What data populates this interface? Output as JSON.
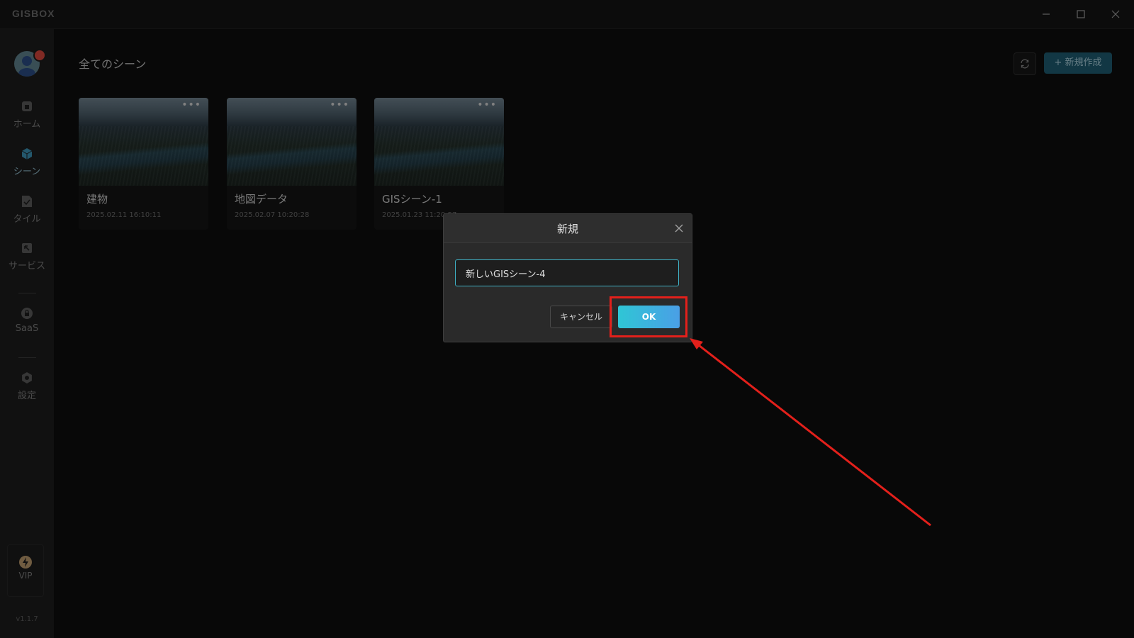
{
  "app": {
    "logo": "GISBOX"
  },
  "sidebar": {
    "items": [
      {
        "id": "home",
        "label": "ホーム"
      },
      {
        "id": "scene",
        "label": "シーン"
      },
      {
        "id": "tile",
        "label": "タイル"
      },
      {
        "id": "service",
        "label": "サービス"
      },
      {
        "id": "saas",
        "label": "SaaS"
      },
      {
        "id": "settings",
        "label": "設定"
      }
    ],
    "vip_label": "VIP",
    "version": "v1.1.7"
  },
  "main": {
    "title": "全てのシーン",
    "new_button": "+ 新規作成",
    "cards": [
      {
        "name": "建物",
        "date": "2025.02.11 16:10:11"
      },
      {
        "name": "地図データ",
        "date": "2025.02.07 10:20:28"
      },
      {
        "name": "GISシーン-1",
        "date": "2025.01.23 11:20:57"
      }
    ],
    "card_menu": "•••"
  },
  "modal": {
    "title": "新規",
    "input_value": "新しいGISシーン-4",
    "cancel_label": "キャンセル",
    "ok_label": "OK"
  },
  "colors": {
    "accent": "#3fb1c6",
    "highlight": "#e3201b",
    "primary_button": "#1e5a6e"
  }
}
